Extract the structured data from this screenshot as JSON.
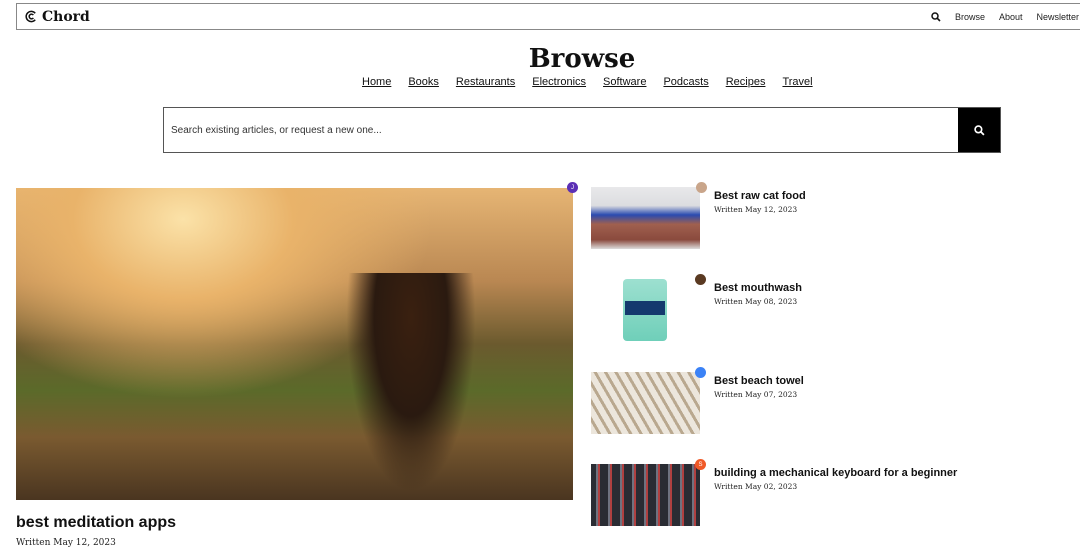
{
  "header": {
    "brand": "Chord",
    "nav": [
      "Browse",
      "About",
      "Newsletter"
    ]
  },
  "page_title": "Browse",
  "categories": [
    "Home",
    "Books",
    "Restaurants",
    "Electronics",
    "Software",
    "Podcasts",
    "Recipes",
    "Travel"
  ],
  "search": {
    "placeholder": "Search existing articles, or request a new one..."
  },
  "featured": {
    "title": "best meditation apps",
    "date": "Written May 12, 2023",
    "badge": "J",
    "badge_color": "#5b2fb5"
  },
  "articles": [
    {
      "title": "Best raw cat food",
      "date": "Written May 12, 2023"
    },
    {
      "title": "Best mouthwash",
      "date": "Written May 08, 2023"
    },
    {
      "title": "Best beach towel",
      "date": "Written May 07, 2023",
      "badge_color": "#3b82f6"
    },
    {
      "title": "building a mechanical keyboard for a beginner",
      "date": "Written May 02, 2023",
      "badge": "S",
      "badge_color": "#f05a28"
    }
  ]
}
